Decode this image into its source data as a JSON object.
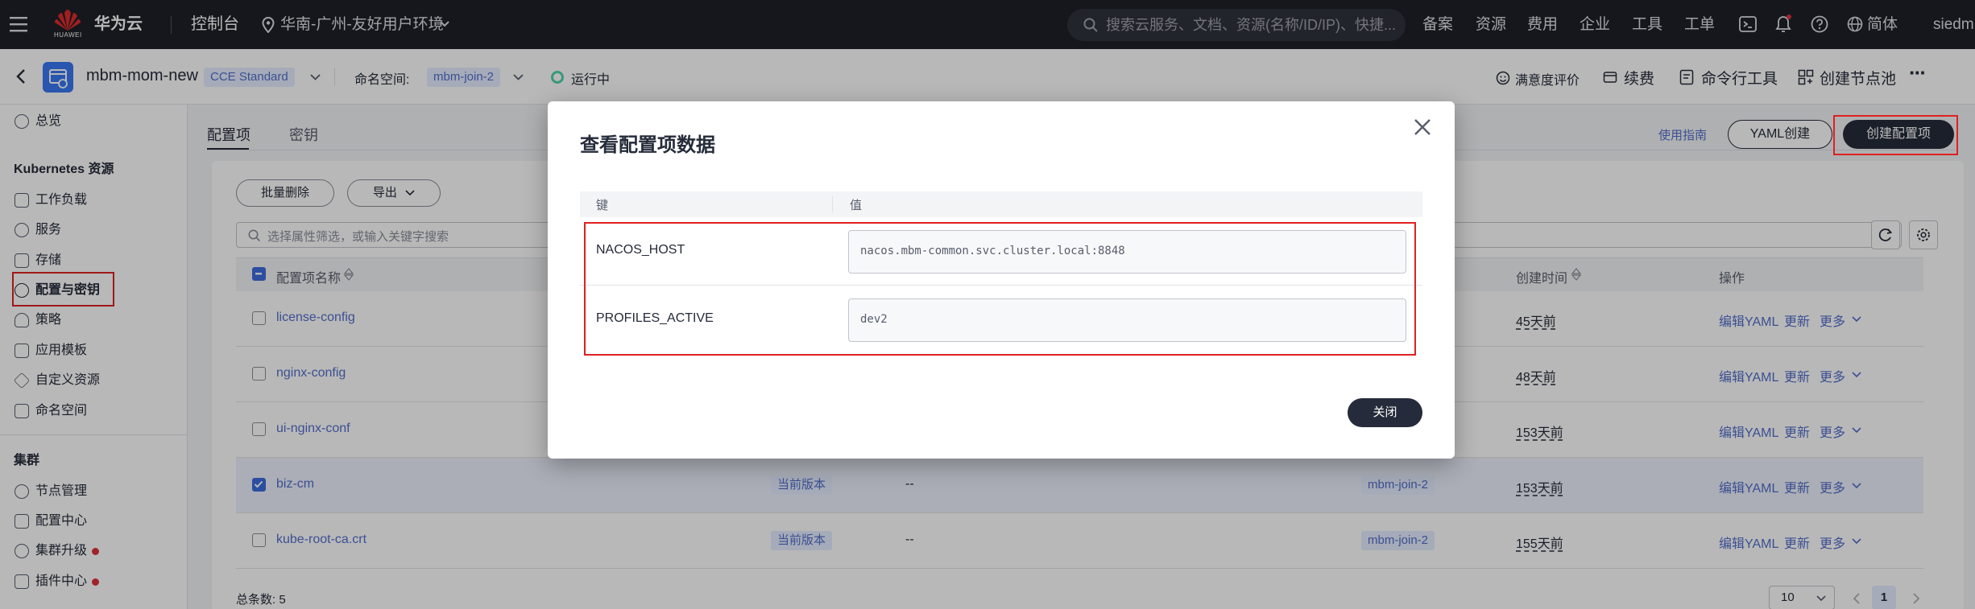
{
  "topnav": {
    "brand": "华为云",
    "brand_sub": "HUAWEI",
    "console": "控制台",
    "region": "华南-广州-友好用户环境",
    "search_placeholder": "搜索云服务、文档、资源(名称/ID/IP)、快捷...",
    "links": [
      "备案",
      "资源",
      "费用",
      "企业",
      "工具",
      "工单"
    ],
    "language": "简体",
    "user": "siedm"
  },
  "cluster_bar": {
    "cluster_name": "mbm-mom-new",
    "edition": "CCE Standard",
    "namespace_label": "命名空间:",
    "namespace": "mbm-join-2",
    "status": "运行中",
    "actions": [
      "满意度评价",
      "续费",
      "命令行工具",
      "创建节点池"
    ],
    "more": "···"
  },
  "sidebar": {
    "overview": "总览",
    "k8s_header": "Kubernetes 资源",
    "k8s_items": [
      "工作负载",
      "服务",
      "存储",
      "配置与密钥",
      "策略",
      "应用模板",
      "自定义资源",
      "命名空间"
    ],
    "cluster_header": "集群",
    "cluster_items": [
      "节点管理",
      "配置中心",
      "集群升级",
      "插件中心"
    ]
  },
  "main": {
    "tabs": [
      "配置项",
      "密钥"
    ],
    "guide_link": "使用指南",
    "yaml_create": "YAML创建",
    "create_config": "创建配置项",
    "batch_delete": "批量删除",
    "export": "导出",
    "filter_placeholder": "选择属性筛选，或输入关键字搜索",
    "columns": [
      "配置项名称",
      "创建时间",
      "操作"
    ],
    "rows": [
      {
        "name": "license-config",
        "version": "",
        "desc": "",
        "ns": "",
        "created": "45天前",
        "checked": false
      },
      {
        "name": "nginx-config",
        "version": "",
        "desc": "",
        "ns": "",
        "created": "48天前",
        "checked": false
      },
      {
        "name": "ui-nginx-conf",
        "version": "",
        "desc": "",
        "ns": "",
        "created": "153天前",
        "checked": false
      },
      {
        "name": "biz-cm",
        "version": "当前版本",
        "desc": "--",
        "ns": "mbm-join-2",
        "created": "153天前",
        "checked": true
      },
      {
        "name": "kube-root-ca.crt",
        "version": "当前版本",
        "desc": "--",
        "ns": "mbm-join-2",
        "created": "155天前",
        "checked": false
      }
    ],
    "row_actions": [
      "编辑YAML",
      "更新",
      "更多"
    ],
    "total_label": "总条数: 5",
    "page_size": "10",
    "current_page": "1"
  },
  "modal": {
    "title": "查看配置项数据",
    "col_key": "键",
    "col_value": "值",
    "entries": [
      {
        "key": "NACOS_HOST",
        "value": "nacos.mbm-common.svc.cluster.local:8848"
      },
      {
        "key": "PROFILES_ACTIVE",
        "value": "dev2"
      }
    ],
    "close_button": "关闭"
  },
  "colors": {
    "accent": "#526ecc",
    "dark": "#252b3a",
    "highlight_red": "#e02020",
    "checkbox": "#3e6de0"
  }
}
